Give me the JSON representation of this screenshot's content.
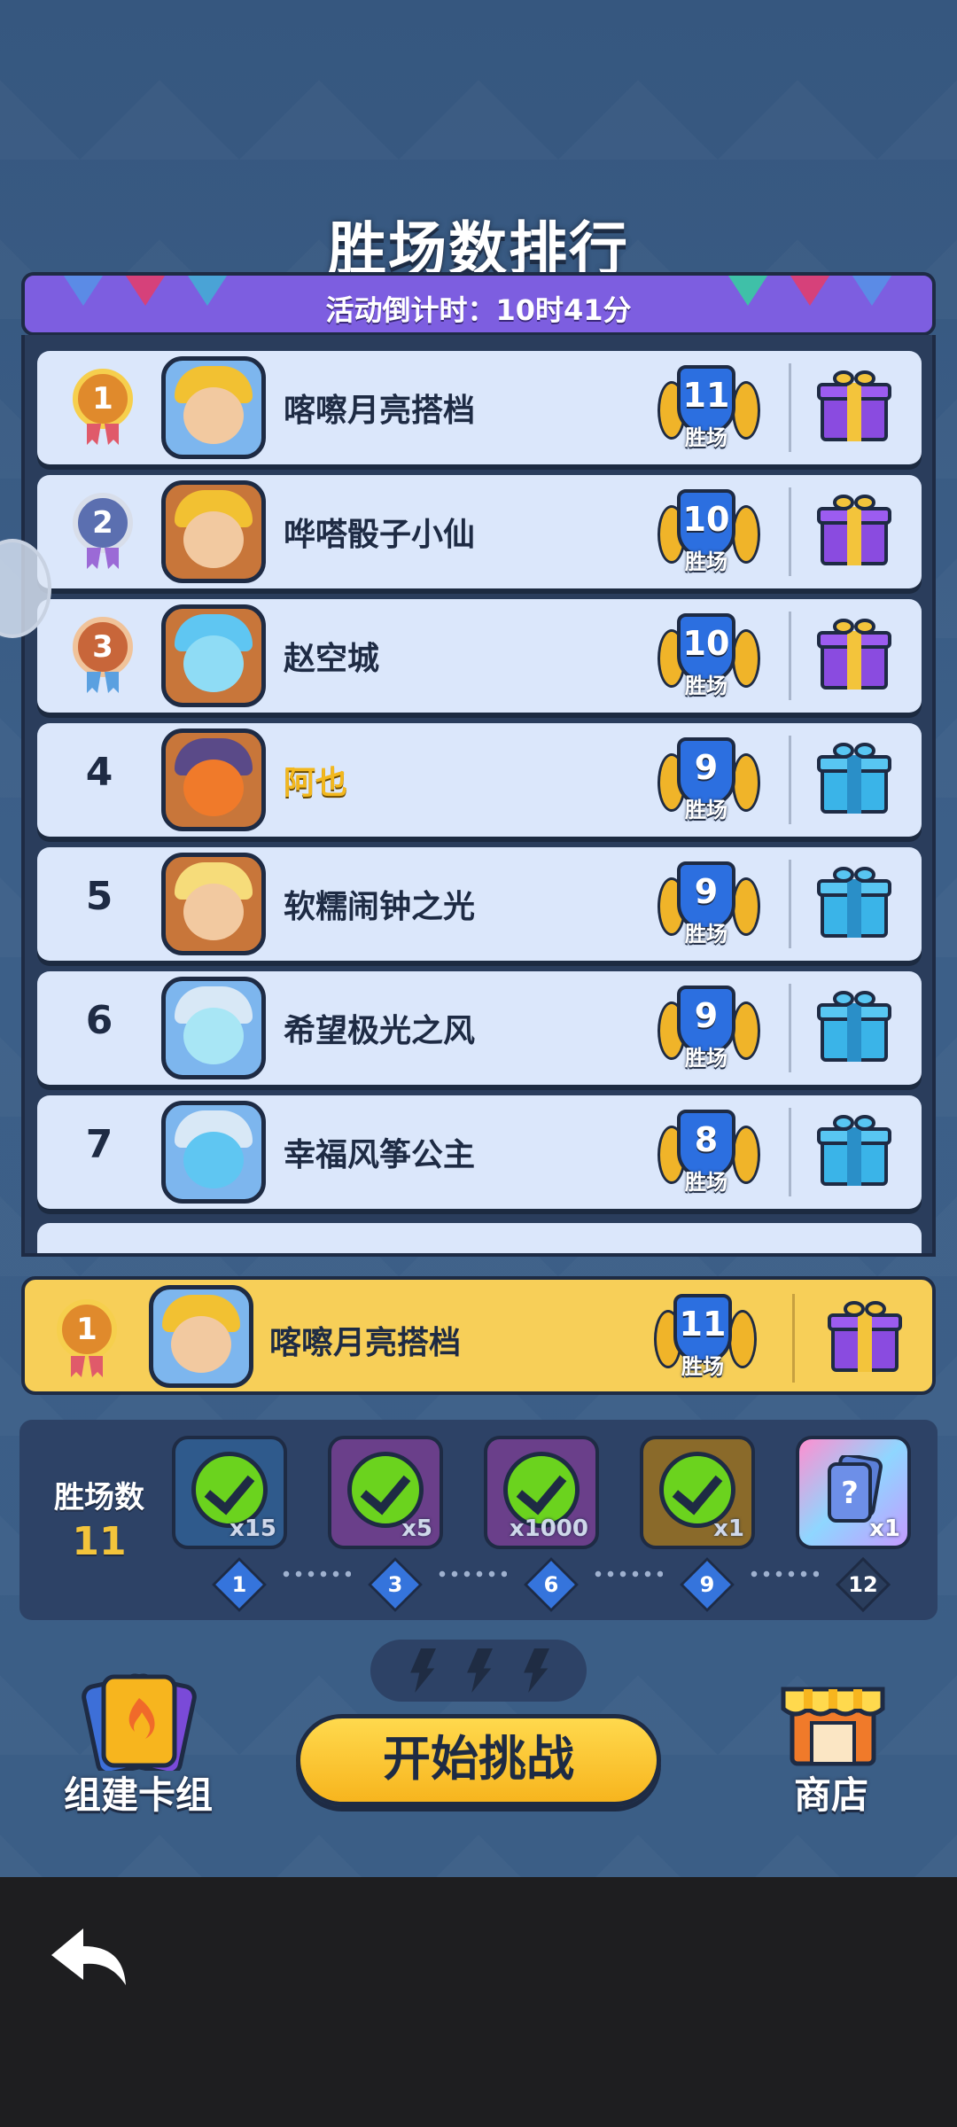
{
  "title": "胜场数排行",
  "countdown": "活动倒计时：10时41分",
  "ranking": [
    {
      "rank": "1",
      "name": "喀嚓月亮搭档",
      "wins": "11",
      "wins_label": "胜场"
    },
    {
      "rank": "2",
      "name": "哗嗒骰子小仙",
      "wins": "10",
      "wins_label": "胜场"
    },
    {
      "rank": "3",
      "name": "赵空城",
      "wins": "10",
      "wins_label": "胜场"
    },
    {
      "rank": "4",
      "name": "阿也",
      "wins": "9",
      "wins_label": "胜场"
    },
    {
      "rank": "5",
      "name": "软糯闹钟之光",
      "wins": "9",
      "wins_label": "胜场"
    },
    {
      "rank": "6",
      "name": "希望极光之风",
      "wins": "9",
      "wins_label": "胜场"
    },
    {
      "rank": "7",
      "name": "幸福风筝公主",
      "wins": "8",
      "wins_label": "胜场"
    }
  ],
  "my_rank": {
    "rank": "1",
    "name": "喀嚓月亮搭档",
    "wins": "11",
    "wins_label": "胜场"
  },
  "progress": {
    "label": "胜场数",
    "count": "11",
    "rewards": [
      {
        "qty": "x15",
        "milestone": "1",
        "claimed": true
      },
      {
        "qty": "x5",
        "milestone": "3",
        "claimed": true
      },
      {
        "qty": "x1000",
        "milestone": "6",
        "claimed": true
      },
      {
        "qty": "x1",
        "milestone": "9",
        "claimed": true
      },
      {
        "qty": "x1",
        "milestone": "12",
        "claimed": false
      }
    ]
  },
  "buttons": {
    "deck": "组建卡组",
    "start": "开始挑战",
    "shop": "商店"
  },
  "colors": {
    "accent": "#f7b51e",
    "top_gift": "#8a4be0",
    "normal_gift": "#3ab4e8",
    "win_shield": "#2c6fe0"
  }
}
